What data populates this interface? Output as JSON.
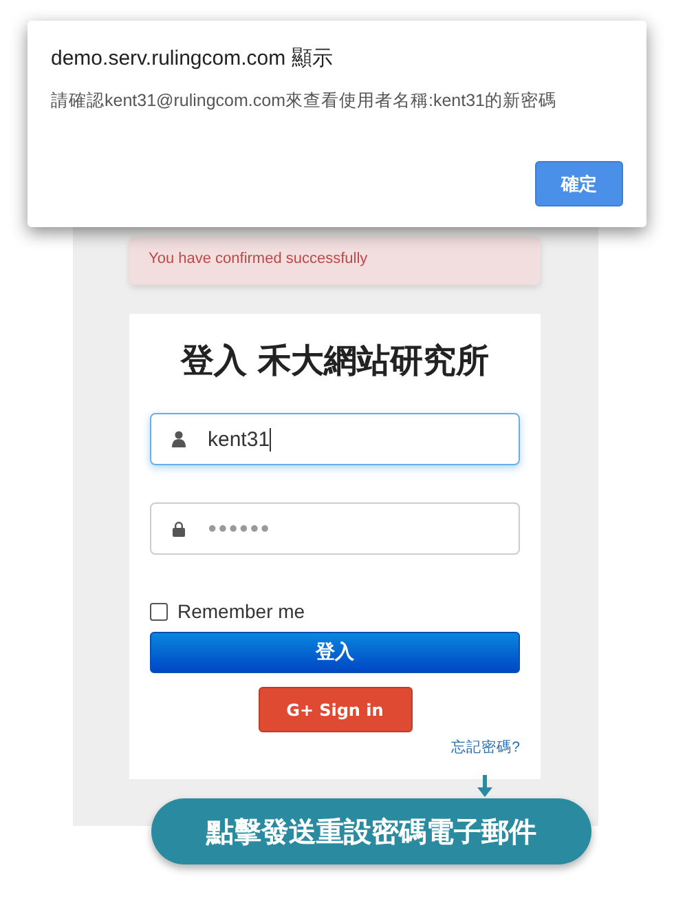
{
  "dialog": {
    "title": "demo.serv.rulingcom.com 顯示",
    "message": "請確認kent31@rulingcom.com來查看使用者名稱:kent31的新密碼",
    "ok_button": "確定"
  },
  "alert": {
    "message": "You have confirmed successfully"
  },
  "login": {
    "title": "登入 禾大網站研究所",
    "username": {
      "value": "kent31",
      "focused": true
    },
    "password": {
      "value": "●●●●●●",
      "focused": false
    },
    "remember": {
      "label": "Remember me",
      "checked": false
    },
    "submit_button": "登入",
    "google_button": {
      "icon": "G+",
      "label": "Sign in"
    },
    "forgot_link": "忘記密碼?"
  },
  "callout": {
    "text": "點擊發送重設密碼電子郵件"
  }
}
